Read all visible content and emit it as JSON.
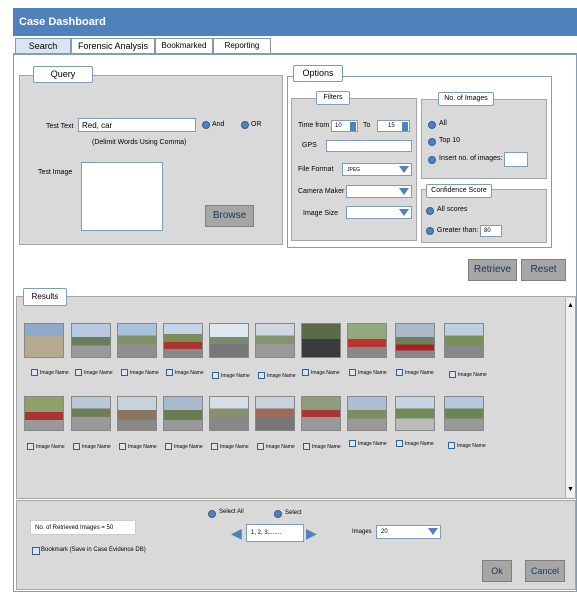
{
  "window": {
    "title": "Case Dashboard"
  },
  "tabs": [
    {
      "label": "Search"
    },
    {
      "label": "Forensic Analysis"
    },
    {
      "label": "Bookmarked"
    },
    {
      "label": "Reporting"
    }
  ],
  "query": {
    "group_label": "Query",
    "test_text_label": "Test Text",
    "test_text_value": "Red, car",
    "and_label": "And",
    "or_label": "OR",
    "delimit_hint": "(Delimit Words Using Comma)",
    "test_image_label": "Test Image",
    "browse_label": "Browse"
  },
  "options": {
    "group_label": "Options",
    "filters": {
      "label": "Filters",
      "time_from_label": "Time from",
      "time_from_value": "10",
      "to_label": "To",
      "time_to_value": "15",
      "gps_label": "GPS",
      "file_format_label": "File Format",
      "file_format_value": "JPEG",
      "camera_maker_label": "Camera Maker",
      "image_size_label": "Image Size"
    },
    "num_images": {
      "label": "No. of Images",
      "all_label": "All",
      "top10_label": "Top 10",
      "insert_label": "Insert no. of images:"
    },
    "confidence": {
      "label": "Confidence Score",
      "all_scores_label": "All scores",
      "greater_than_label": "Greater than:",
      "greater_than_value": "80"
    }
  },
  "actions": {
    "retrieve_label": "Retrieve",
    "reset_label": "Reset"
  },
  "results": {
    "label": "Results",
    "row1": [
      "Image Name",
      "Image Name",
      "Image Name",
      "Image Name",
      "Image Name",
      "Image Name",
      "Image Name",
      "Image Name",
      "Image Name",
      "Image Name"
    ],
    "row2": [
      "Image Name",
      "Image Name",
      "Image Name",
      "Image Name",
      "Image Name",
      "Image Name",
      "Image Name",
      "Image Name",
      "Image Name",
      "Image Name"
    ]
  },
  "footer": {
    "retrieved_count": "No. of Retrieved Images = 50",
    "select_all_label": "Select All",
    "select_label": "Select",
    "pages_value": "1, 2, 3,.......",
    "images_label": "Images",
    "images_value": "20",
    "bookmark_label": "Bookmark (Save in Case Evidence DB)",
    "ok_label": "Ok",
    "cancel_label": "Cancel"
  },
  "colors": {
    "accent": "#4f81bd",
    "panel": "#d9d9d9"
  }
}
